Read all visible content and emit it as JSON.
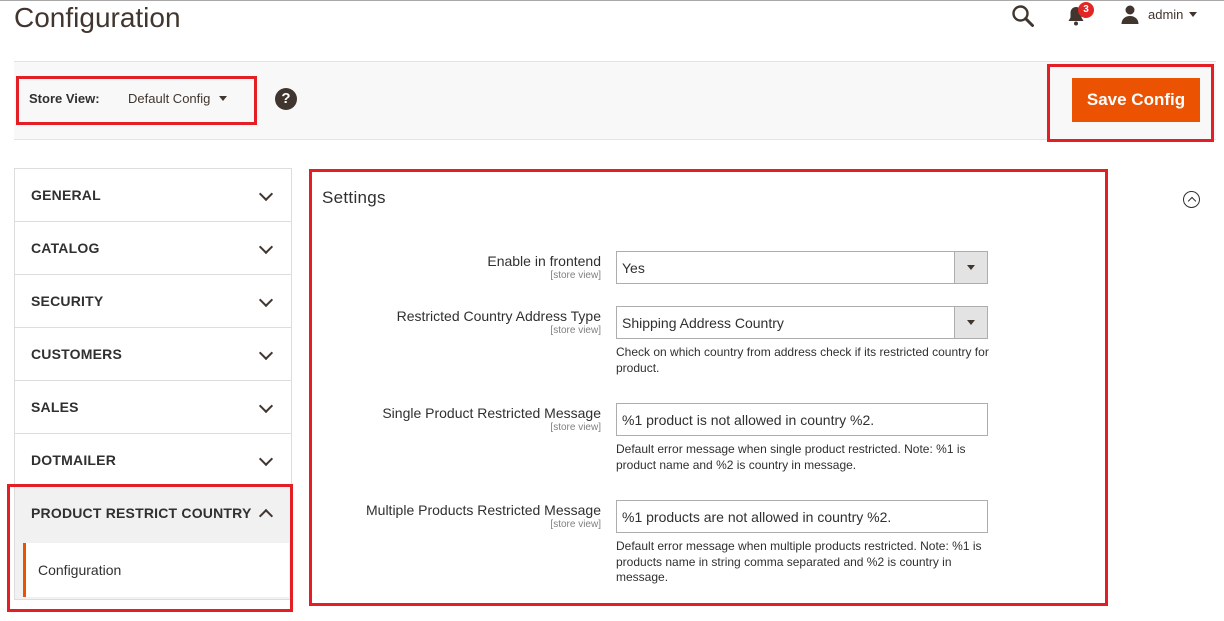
{
  "page": {
    "title": "Configuration"
  },
  "header": {
    "notifications_count": "3",
    "user_name": "admin"
  },
  "store_view": {
    "label": "Store View:",
    "value": "Default Config",
    "help": "?"
  },
  "actions": {
    "save_label": "Save Config"
  },
  "sidebar": {
    "items": [
      {
        "label": "GENERAL"
      },
      {
        "label": "CATALOG"
      },
      {
        "label": "SECURITY"
      },
      {
        "label": "CUSTOMERS"
      },
      {
        "label": "SALES"
      },
      {
        "label": "DOTMAILER"
      },
      {
        "label": "PRODUCT RESTRICT COUNTRY"
      }
    ],
    "subitem": "Configuration"
  },
  "settings": {
    "title": "Settings",
    "fields": [
      {
        "label": "Enable in frontend",
        "scope": "[store view]",
        "value": "Yes"
      },
      {
        "label": "Restricted Country Address Type",
        "scope": "[store view]",
        "value": "Shipping Address Country",
        "note": "Check on which country from address check if its restricted country for product."
      },
      {
        "label": "Single Product Restricted Message",
        "scope": "[store view]",
        "value": "%1 product is not allowed in country %2.",
        "note": "Default error message when single product restricted. Note: %1 is product name and %2 is country in message."
      },
      {
        "label": "Multiple Products Restricted Message",
        "scope": "[store view]",
        "value": "%1 products are not allowed in country %2.",
        "note": "Default error message when multiple products restricted. Note: %1 is products name in string comma separated and %2 is country in message."
      }
    ]
  },
  "colors": {
    "accent": "#eb5202",
    "highlight": "#e31e24",
    "badge": "#e22626"
  },
  "icons": [
    "search-icon",
    "bell-icon",
    "user-icon",
    "help-icon",
    "chevron-down-icon",
    "chevron-up-icon",
    "collapse-icon"
  ]
}
